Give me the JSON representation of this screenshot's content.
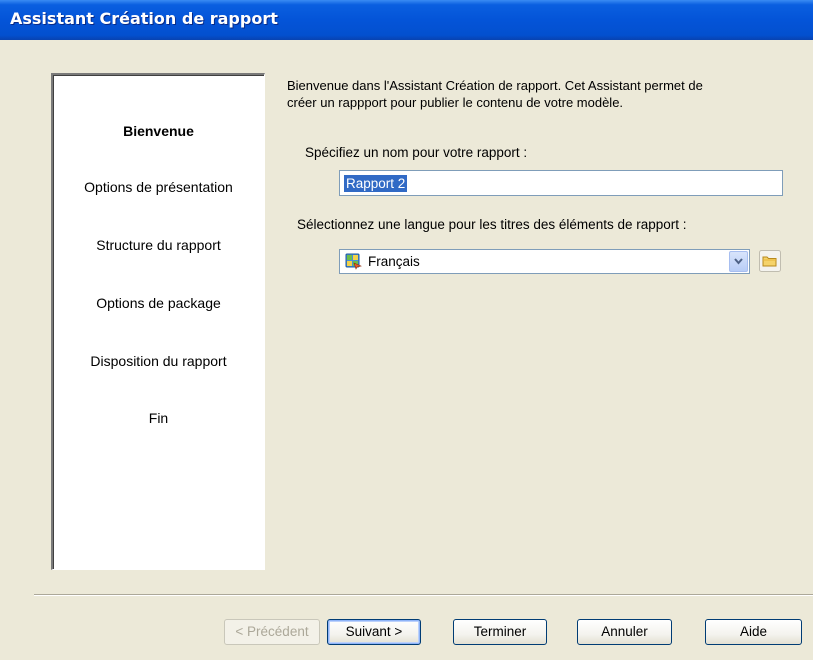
{
  "window": {
    "title": "Assistant Création de rapport"
  },
  "nav": {
    "items": [
      {
        "label": "Bienvenue",
        "active": true
      },
      {
        "label": "Options de présentation",
        "active": false
      },
      {
        "label": "Structure du rapport",
        "active": false
      },
      {
        "label": "Options de package",
        "active": false
      },
      {
        "label": "Disposition du rapport",
        "active": false
      },
      {
        "label": "Fin",
        "active": false
      }
    ]
  },
  "main": {
    "welcome_line1": "Bienvenue dans l'Assistant Création de rapport. Cet Assistant permet de",
    "welcome_line2": "créer un rappport pour publier le contenu de votre modèle.",
    "name_label": "Spécifiez un nom pour votre rapport :",
    "name_value": "Rapport 2",
    "language_label": "Sélectionnez une langue pour les titres des éléments de rapport :",
    "language_value": "Français",
    "language_icon": "language-flag-icon",
    "folder_icon": "folder-icon"
  },
  "footer": {
    "prev_label": "< Précédent",
    "next_label": "Suivant >",
    "finish_label": "Terminer",
    "cancel_label": "Annuler",
    "help_label": "Aide"
  },
  "colors": {
    "titlebar": "#0454d8",
    "dialog_bg": "#ece9d8",
    "selection": "#316ac5",
    "input_border": "#7f9db9"
  }
}
